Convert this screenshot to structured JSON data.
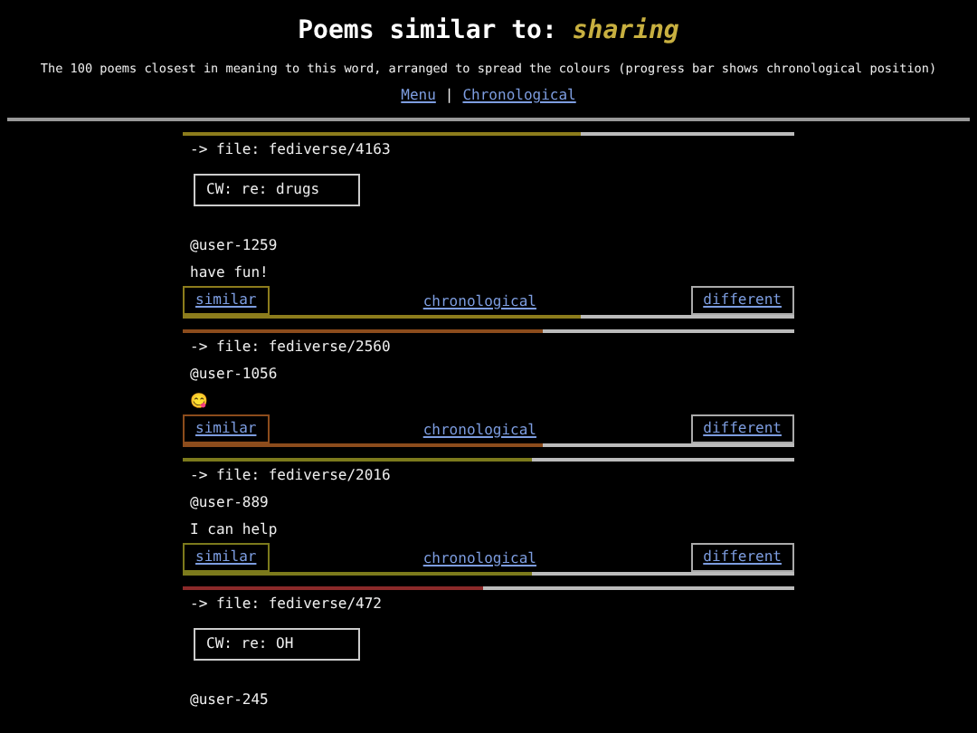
{
  "header": {
    "title": "Poems similar to:",
    "word": "sharing",
    "subtitle": "The 100 poems closest in meaning to this word, arranged to spread the colours (progress bar shows chronological position)",
    "links": [
      "Menu",
      "Chronological"
    ],
    "separator": "|"
  },
  "poems": [
    {
      "color": "#8c7c1c",
      "level": 0.65,
      "file": "-> file: fediverse/4163",
      "cw": "CW: re: drugs",
      "user": "@user-1259",
      "text": "have fun!",
      "nav": {
        "similar": "similar",
        "chronological": "chronological",
        "different": "different"
      }
    },
    {
      "color": "#8c4c1c",
      "level": 0.59,
      "file": "-> file: fediverse/2560",
      "user": "@user-1056",
      "text": "😋",
      "nav": {
        "similar": "similar",
        "chronological": "chronological",
        "different": "different"
      }
    },
    {
      "color": "#7c7a1c",
      "level": 0.57,
      "file": "-> file: fediverse/2016",
      "user": "@user-889",
      "text": "I can help",
      "nav": {
        "similar": "similar",
        "chronological": "chronological",
        "different": "different"
      }
    },
    {
      "color": "#8c2a2a",
      "level": 0.49,
      "file": "-> file: fediverse/472",
      "cw": "CW: re: OH",
      "user": "@user-245"
    }
  ]
}
